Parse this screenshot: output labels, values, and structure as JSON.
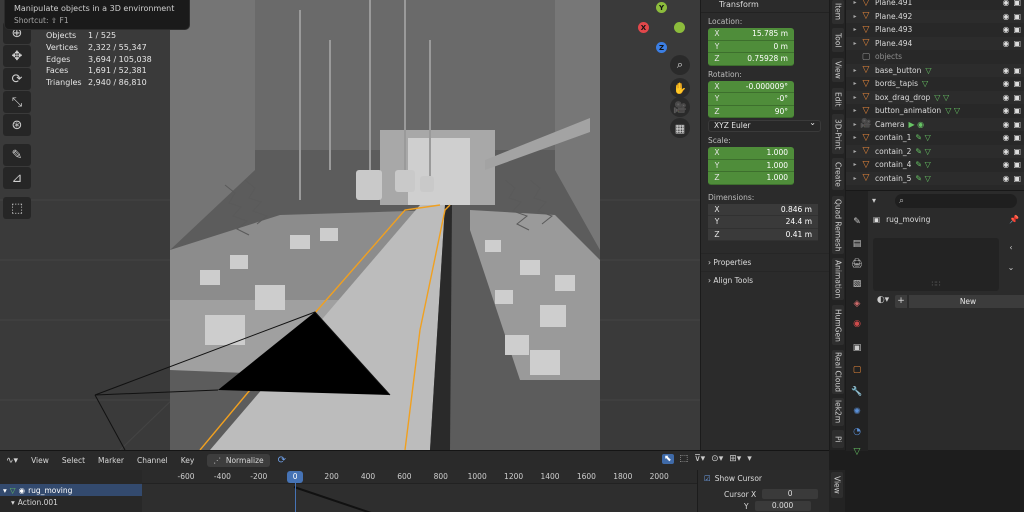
{
  "tooltip": {
    "title": "Manipulate objects in a 3D environment",
    "shortcut": "Shortcut: ⇧ F1"
  },
  "stats": [
    {
      "label": "Objects",
      "value": "1 / 525"
    },
    {
      "label": "Vertices",
      "value": "2,322 / 55,347"
    },
    {
      "label": "Edges",
      "value": "3,694 / 105,038"
    },
    {
      "label": "Faces",
      "value": "1,691 / 52,381"
    },
    {
      "label": "Triangles",
      "value": "2,940 / 86,810"
    }
  ],
  "toolbar": {
    "tools": [
      "select-box-icon",
      "cursor-icon",
      "move-icon",
      "rotate-icon",
      "scale-icon",
      "transform-icon",
      "annotate-icon",
      "measure-icon",
      "add-cube-icon"
    ]
  },
  "gizmo": {
    "y": "Y",
    "x": "X",
    "z": "Z"
  },
  "transform": {
    "header": "Transform",
    "location_label": "Location:",
    "location": [
      {
        "axis": "X",
        "value": "15.785 m"
      },
      {
        "axis": "Y",
        "value": "0 m"
      },
      {
        "axis": "Z",
        "value": "0.75928 m"
      }
    ],
    "rotation_label": "Rotation:",
    "rotation": [
      {
        "axis": "X",
        "value": "-0.000009°"
      },
      {
        "axis": "Y",
        "value": "-0°"
      },
      {
        "axis": "Z",
        "value": "90°"
      }
    ],
    "rotation_mode": "XYZ Euler",
    "scale_label": "Scale:",
    "scale": [
      {
        "axis": "X",
        "value": "1.000"
      },
      {
        "axis": "Y",
        "value": "1.000"
      },
      {
        "axis": "Z",
        "value": "1.000"
      }
    ],
    "dimensions_label": "Dimensions:",
    "dimensions": [
      {
        "axis": "X",
        "value": "0.846 m"
      },
      {
        "axis": "Y",
        "value": "24.4 m"
      },
      {
        "axis": "Z",
        "value": "0.41 m"
      }
    ],
    "properties": "Properties",
    "align_tools": "Align Tools"
  },
  "sidebar_tabs": [
    "Item",
    "Tool",
    "View",
    "Edit",
    "3D-Print",
    "Create",
    "Quad Remesh",
    "Animation",
    "HumGen",
    "Real Cloud",
    "lek2m",
    "Pi"
  ],
  "outliner": {
    "rows": [
      {
        "label": "Plane.491",
        "type": "plane"
      },
      {
        "label": "Plane.492",
        "type": "plane"
      },
      {
        "label": "Plane.493",
        "type": "plane"
      },
      {
        "label": "Plane.494",
        "type": "plane"
      },
      {
        "label": "objects",
        "type": "group"
      },
      {
        "label": "base_button",
        "type": "object",
        "mods": "▽"
      },
      {
        "label": "bords_tapis",
        "type": "object",
        "mods": "▽"
      },
      {
        "label": "box_drag_drop",
        "type": "object",
        "mods": "▽ ▽"
      },
      {
        "label": "button_animation",
        "type": "object",
        "mods": "▽ ▽"
      },
      {
        "label": "Camera",
        "type": "camera",
        "mods": "▶ ◉"
      },
      {
        "label": "contain_1",
        "type": "object",
        "mods": "✎ ▽"
      },
      {
        "label": "contain_2",
        "type": "object",
        "mods": "✎ ▽"
      },
      {
        "label": "contain_4",
        "type": "object",
        "mods": "✎ ▽"
      },
      {
        "label": "contain_5",
        "type": "object",
        "mods": "✎ ▽"
      }
    ]
  },
  "properties_editor": {
    "action_name": "rug_moving",
    "new_label": "New",
    "search_icon": "⌕"
  },
  "timeline": {
    "menus": [
      "View",
      "Select",
      "Marker",
      "Channel",
      "Key"
    ],
    "normalize": "Normalize",
    "frames": [
      "-600",
      "-400",
      "-200",
      "0",
      "200",
      "400",
      "600",
      "800",
      "1000",
      "1200",
      "1400",
      "1600",
      "1800",
      "2000"
    ],
    "current_frame": "0",
    "channels": [
      {
        "label": "rug_moving",
        "selected": true
      },
      {
        "label": "Action.001",
        "selected": false
      }
    ],
    "show_cursor": "Show Cursor",
    "cursor_x_label": "Cursor X",
    "cursor_x": "0",
    "cursor_y_label": "Y",
    "cursor_y": "0.000",
    "side_tabs": [
      "View"
    ]
  },
  "colors": {
    "accent_blue": "#4673b5",
    "field_green": "#4f8d3a",
    "selection_orange": "#f0a020",
    "axis_x": "#e2474b",
    "axis_y": "#8cbc3c",
    "axis_z": "#3b7ee3"
  }
}
